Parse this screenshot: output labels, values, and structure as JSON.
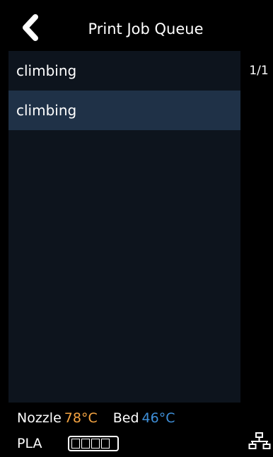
{
  "header": {
    "title": "Print Job Queue",
    "back_icon": "chevron-left-icon"
  },
  "queue": {
    "items": [
      {
        "label": "climbing",
        "selected": false
      },
      {
        "label": "climbing",
        "selected": true
      }
    ],
    "page_indicator": "1/1"
  },
  "status": {
    "nozzle_label": "Nozzle",
    "nozzle_temp": "78°C",
    "bed_label": "Bed",
    "bed_temp": "46°C",
    "material": "PLA",
    "filament_segments": 4,
    "network_icon": "network-icon"
  },
  "colors": {
    "background": "#000000",
    "list_background": "#0d141d",
    "selected_row": "#1f3147",
    "nozzle_temp": "#f5a442",
    "bed_temp": "#3f8fd8",
    "text": "#ffffff"
  }
}
